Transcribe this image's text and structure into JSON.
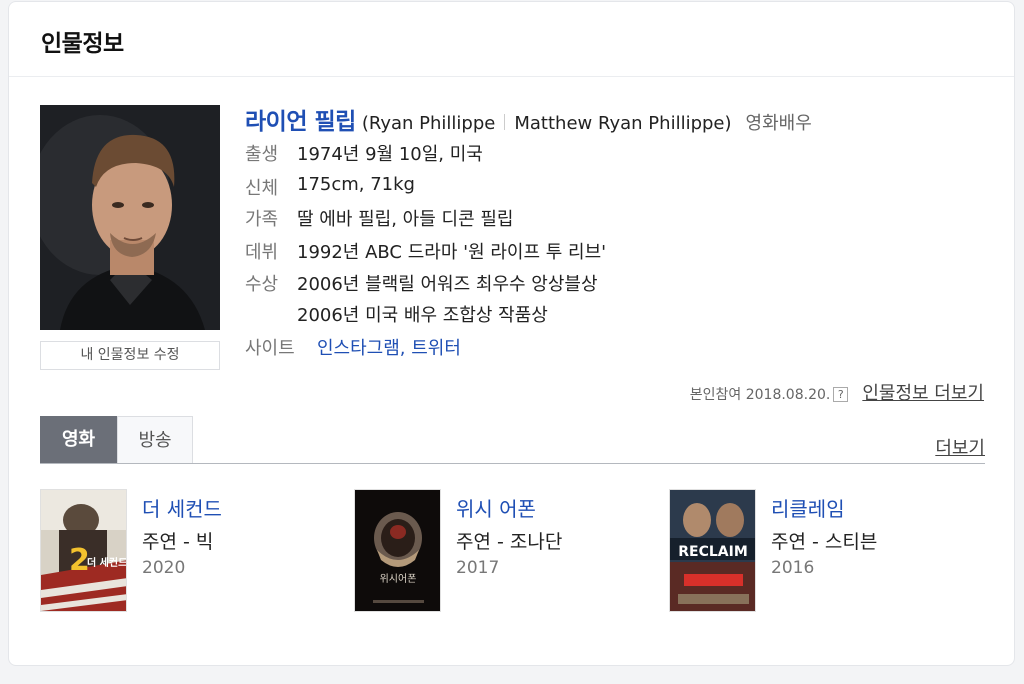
{
  "header": {
    "title": "인물정보"
  },
  "person": {
    "name_ko": "라이언 필립",
    "name_en_open": "(Ryan Phillippe",
    "name_en_full": "Matthew Ryan Phillippe)",
    "occupation": "영화배우"
  },
  "details": {
    "birth": {
      "label": "출생",
      "value": "1974년 9월 10일, 미국"
    },
    "body": {
      "label": "신체",
      "value": "175cm, 71kg"
    },
    "family": {
      "label": "가족",
      "value": "딸 에바 필립, 아들 디콘 필립"
    },
    "debut": {
      "label": "데뷔",
      "value": "1992년 ABC 드라마 '원 라이프 투 리브'"
    },
    "awards": {
      "label": "수상",
      "value1": "2006년 블랙릴 어워즈 최우수 앙상블상",
      "value2": "2006년 미국 배우 조합상 작품상"
    },
    "site": {
      "label": "사이트",
      "value": "인스타그램, 트위터"
    }
  },
  "edit_button": "내 인물정보 수정",
  "source": {
    "text": "본인참여 2018.08.20.",
    "help": "?",
    "more": "인물정보 더보기"
  },
  "tabs": {
    "movie": "영화",
    "broadcast": "방송",
    "more": "더보기"
  },
  "films": [
    {
      "title": "더 세컨드",
      "role": "주연 - 빅",
      "year": "2020",
      "poster_text": "더 세컨드"
    },
    {
      "title": "위시 어폰",
      "role": "주연 - 조나단",
      "year": "2017",
      "poster_text": "위시어폰"
    },
    {
      "title": "리클레임",
      "role": "주연 - 스티븐",
      "year": "2016",
      "poster_text": "RECLAIM"
    }
  ],
  "colors": {
    "link": "#1f4fb4",
    "active_tab": "#6b6f78"
  }
}
